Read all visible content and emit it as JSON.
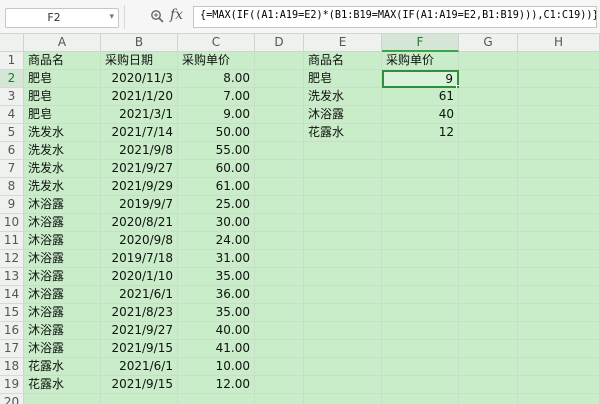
{
  "formula_bar": {
    "name_box": "F2",
    "fx_label": "fx",
    "formula": "{=MAX(IF((A1:A19=E2)*(B1:B19=MAX(IF(A1:A19=E2,B1:B19))),C1:C19))}"
  },
  "columns": [
    "A",
    "B",
    "C",
    "D",
    "E",
    "F",
    "G",
    "H"
  ],
  "row_numbers": [
    "1",
    "2",
    "3",
    "4",
    "5",
    "6",
    "7",
    "8",
    "9",
    "10",
    "11",
    "12",
    "13",
    "14",
    "15",
    "16",
    "17",
    "18",
    "19",
    "20"
  ],
  "headers": {
    "name": "商品名",
    "date": "采购日期",
    "price": "采购单价"
  },
  "left_rows": [
    {
      "name": "肥皂",
      "date": "2020/11/3",
      "price": "8.00"
    },
    {
      "name": "肥皂",
      "date": "2021/1/20",
      "price": "7.00"
    },
    {
      "name": "肥皂",
      "date": "2021/3/1",
      "price": "9.00"
    },
    {
      "name": "洗发水",
      "date": "2021/7/14",
      "price": "50.00"
    },
    {
      "name": "洗发水",
      "date": "2021/9/8",
      "price": "55.00"
    },
    {
      "name": "洗发水",
      "date": "2021/9/27",
      "price": "60.00"
    },
    {
      "name": "洗发水",
      "date": "2021/9/29",
      "price": "61.00"
    },
    {
      "name": "沐浴露",
      "date": "2019/9/7",
      "price": "25.00"
    },
    {
      "name": "沐浴露",
      "date": "2020/8/21",
      "price": "30.00"
    },
    {
      "name": "沐浴露",
      "date": "2020/9/8",
      "price": "24.00"
    },
    {
      "name": "沐浴露",
      "date": "2019/7/18",
      "price": "31.00"
    },
    {
      "name": "沐浴露",
      "date": "2020/1/10",
      "price": "35.00"
    },
    {
      "name": "沐浴露",
      "date": "2021/6/1",
      "price": "36.00"
    },
    {
      "name": "沐浴露",
      "date": "2021/8/23",
      "price": "35.00"
    },
    {
      "name": "沐浴露",
      "date": "2021/9/27",
      "price": "40.00"
    },
    {
      "name": "沐浴露",
      "date": "2021/9/15",
      "price": "41.00"
    },
    {
      "name": "花露水",
      "date": "2021/6/1",
      "price": "10.00"
    },
    {
      "name": "花露水",
      "date": "2021/9/15",
      "price": "12.00"
    }
  ],
  "right_headers": {
    "name": "商品名",
    "price": "采购单价"
  },
  "right_rows": [
    {
      "name": "肥皂",
      "price": "9"
    },
    {
      "name": "洗发水",
      "price": "61"
    },
    {
      "name": "沐浴露",
      "price": "40"
    },
    {
      "name": "花露水",
      "price": "12"
    }
  ],
  "selection": {
    "column": "F",
    "row": "2"
  }
}
